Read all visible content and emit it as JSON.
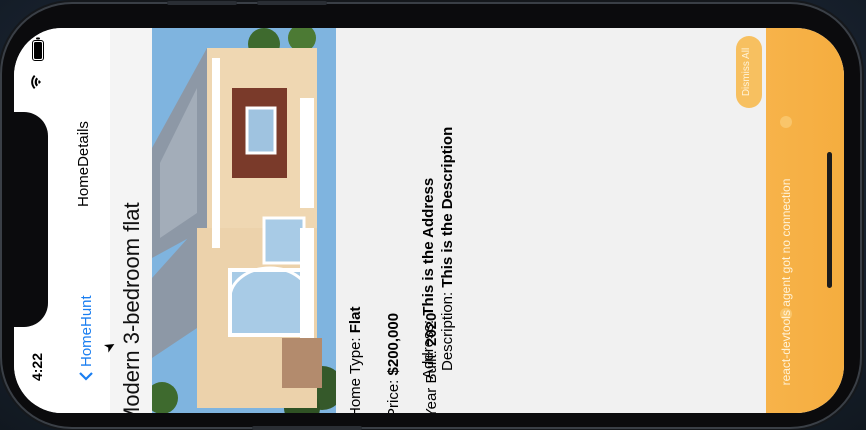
{
  "status_bar": {
    "time": "4:22",
    "wifi_icon": "wifi-icon",
    "battery_icon": "battery-icon"
  },
  "nav": {
    "back_label": "HomeHunt",
    "title": "HomeDetails"
  },
  "home": {
    "title": "Modern 3-bedroom flat",
    "image_icon": "house-photo",
    "type_label": "Home Type: ",
    "type_value": "Flat",
    "price_label": "Price: ",
    "price_value": "$200,000",
    "year_label": "Year Built: ",
    "year_value": "2020",
    "address_label": "Address: ",
    "address_value": "This is the Address",
    "description_label": "Description: ",
    "description_value": "This is the Description"
  },
  "devtools": {
    "dismiss_label": "Dismiss All",
    "message": "react-devtools agent got no connection"
  },
  "colors": {
    "accent": "#1a7ef0",
    "devtools_bar": "#f5ad3f"
  }
}
